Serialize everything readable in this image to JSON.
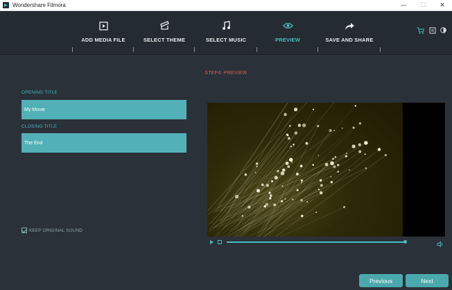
{
  "window": {
    "title": "Wondershare Filmora",
    "controls": {
      "minimize": "—",
      "maximize": "☐",
      "close": "✕"
    }
  },
  "nav": {
    "steps": [
      {
        "label": "ADD MEDIA FILE",
        "icon": "media-file-icon",
        "active": false
      },
      {
        "label": "SELECT THEME",
        "icon": "theme-icon",
        "active": false
      },
      {
        "label": "SELECT MUSIC",
        "icon": "music-note-icon",
        "active": false
      },
      {
        "label": "PREVIEW",
        "icon": "eye-icon",
        "active": true
      },
      {
        "label": "SAVE AND SHARE",
        "icon": "share-arrow-icon",
        "active": false
      }
    ],
    "tools": [
      "cart-icon",
      "feedback-icon",
      "brightness-icon"
    ],
    "accent": "#4bbcc0"
  },
  "main": {
    "step_heading": "STEP4: PREVIEW",
    "opening_title": {
      "label": "OPENING TITLE",
      "value": "My Movie"
    },
    "closing_title": {
      "label": "CLOSING TITLE",
      "value": "The End"
    },
    "keep_sound": {
      "label": "KEEP ORIGINAL SOUND",
      "checked": true
    }
  },
  "player": {
    "progress": 0.99,
    "controls": [
      "play-icon",
      "stop-icon",
      "volume-icon"
    ]
  },
  "footer": {
    "previous_label": "Previous",
    "next_label": "Next"
  }
}
